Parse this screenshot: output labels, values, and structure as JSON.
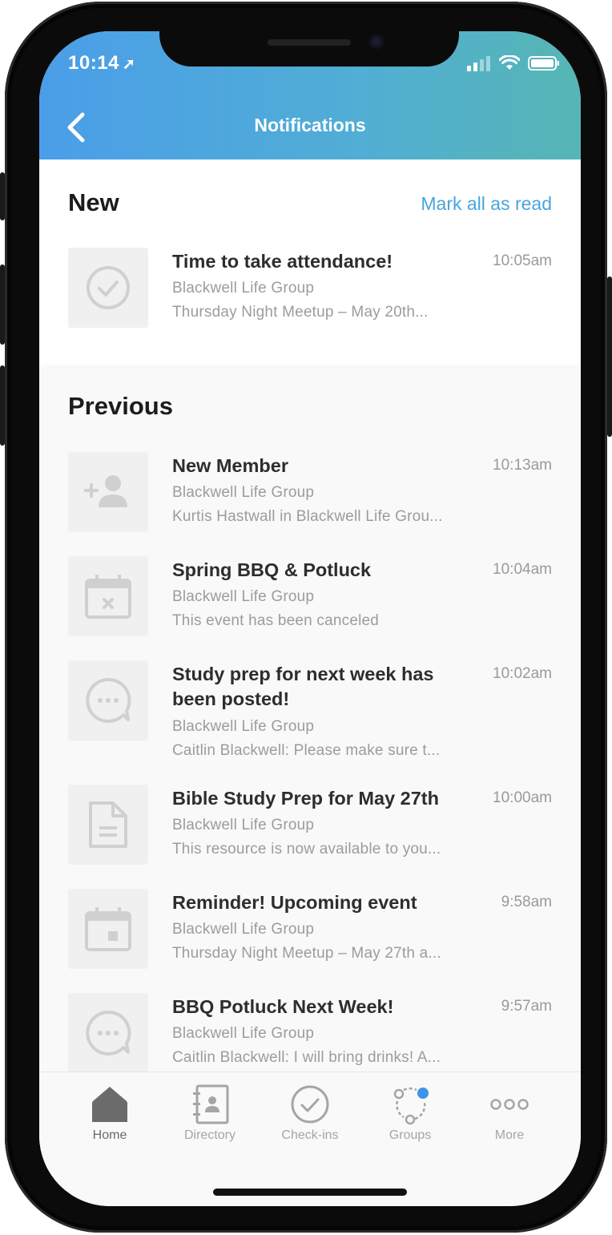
{
  "status_bar": {
    "time": "10:14"
  },
  "header": {
    "title": "Notifications"
  },
  "new_section": {
    "title": "New",
    "mark_all_label": "Mark all as read",
    "items": [
      {
        "icon": "check-circle-icon",
        "title": "Time to take attendance!",
        "time": "10:05am",
        "group": "Blackwell Life Group",
        "message": "Thursday Night Meetup – May 20th..."
      }
    ]
  },
  "previous_section": {
    "title": "Previous",
    "items": [
      {
        "icon": "add-user-icon",
        "title": "New Member",
        "time": "10:13am",
        "group": "Blackwell Life Group",
        "message": "Kurtis Hastwall in Blackwell Life Grou..."
      },
      {
        "icon": "calendar-cancel-icon",
        "title": "Spring BBQ & Potluck",
        "time": "10:04am",
        "group": "Blackwell Life Group",
        "message": "This event has been canceled"
      },
      {
        "icon": "chat-bubble-icon",
        "title": "Study prep for next week has been posted!",
        "time": "10:02am",
        "group": "Blackwell Life Group",
        "message": "Caitlin Blackwell: Please make sure t..."
      },
      {
        "icon": "document-icon",
        "title": "Bible Study Prep for May 27th",
        "time": "10:00am",
        "group": "Blackwell Life Group",
        "message": "This resource is now available to you..."
      },
      {
        "icon": "calendar-event-icon",
        "title": "Reminder! Upcoming event",
        "time": "9:58am",
        "group": "Blackwell Life Group",
        "message": "Thursday Night Meetup – May 27th a..."
      },
      {
        "icon": "chat-bubble-icon",
        "title": "BBQ Potluck Next Week!",
        "time": "9:57am",
        "group": "Blackwell Life Group",
        "message": "Caitlin Blackwell: I will bring drinks! A..."
      }
    ]
  },
  "tabbar": {
    "tabs": [
      {
        "label": "Home",
        "icon": "home-icon",
        "active": true
      },
      {
        "label": "Directory",
        "icon": "directory-icon",
        "active": false
      },
      {
        "label": "Check-ins",
        "icon": "check-circle-icon",
        "active": false
      },
      {
        "label": "Groups",
        "icon": "groups-icon",
        "active": false,
        "badge": true
      },
      {
        "label": "More",
        "icon": "more-icon",
        "active": false
      }
    ]
  },
  "colors": {
    "header_gradient_start": "#4a9ee8",
    "header_gradient_end": "#56b6b4",
    "link": "#4aa4dd",
    "badge": "#3c95e8"
  }
}
